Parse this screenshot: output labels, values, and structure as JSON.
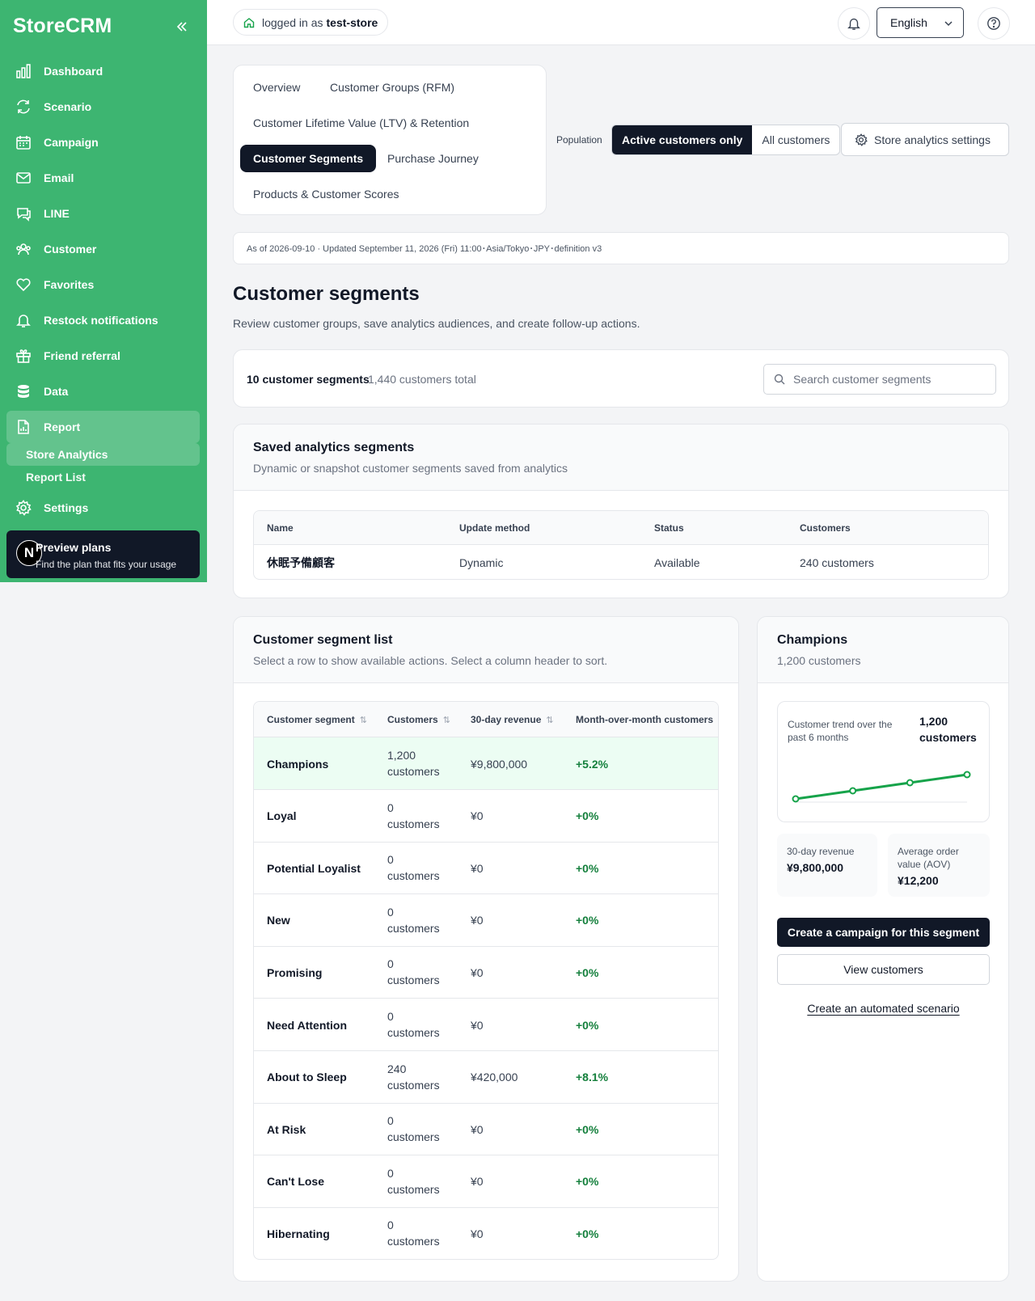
{
  "app": {
    "brand": "StoreCRM"
  },
  "sidebar": {
    "items": [
      {
        "label": "Dashboard",
        "icon": "bar-chart-icon"
      },
      {
        "label": "Scenario",
        "icon": "refresh-icon"
      },
      {
        "label": "Campaign",
        "icon": "calendar-icon"
      },
      {
        "label": "Email",
        "icon": "mail-icon"
      },
      {
        "label": "LINE",
        "icon": "chat-icon"
      },
      {
        "label": "Customer",
        "icon": "users-icon"
      },
      {
        "label": "Favorites",
        "icon": "heart-icon"
      },
      {
        "label": "Restock notifications",
        "icon": "bell-icon"
      },
      {
        "label": "Friend referral",
        "icon": "gift-icon"
      },
      {
        "label": "Data",
        "icon": "database-icon"
      },
      {
        "label": "Report",
        "icon": "report-icon"
      }
    ],
    "sub_items": [
      {
        "label": "Store Analytics"
      },
      {
        "label": "Report List"
      }
    ],
    "settings": {
      "label": "Settings",
      "icon": "gear-icon"
    },
    "plans": {
      "badge": "N",
      "title": "Preview plans",
      "subtitle": "Find the plan that fits your usage"
    }
  },
  "topbar": {
    "login_prefix": "logged in as",
    "store": "test-store",
    "language": "English"
  },
  "tabs": [
    {
      "label": "Overview"
    },
    {
      "label": "Customer Groups (RFM)"
    },
    {
      "label": "Customer Lifetime Value (LTV) & Retention"
    },
    {
      "label": "Customer Segments"
    },
    {
      "label": "Purchase Journey"
    },
    {
      "label": "Products & Customer Scores"
    }
  ],
  "population": {
    "label": "Population",
    "options": [
      "Active customers only",
      "All customers"
    ],
    "selected": "Active customers only",
    "settings_label": "Store analytics settings"
  },
  "asof": "As of 2026-09-10 · Updated September 11, 2026 (Fri) 11:00･Asia/Tokyo･JPY･definition v3",
  "page": {
    "title": "Customer segments",
    "subtitle": "Review customer groups, save analytics audiences, and create follow-up actions."
  },
  "summary": {
    "count": "10 customer segments",
    "total": "1,440 customers total",
    "search_placeholder": "Search customer segments"
  },
  "saved": {
    "title": "Saved analytics segments",
    "subtitle": "Dynamic or snapshot customer segments saved from analytics",
    "columns": [
      "Name",
      "Update method",
      "Status",
      "Customers"
    ],
    "rows": [
      {
        "name": "休眠予備顧客",
        "method": "Dynamic",
        "status": "Available",
        "customers": "240 customers"
      }
    ]
  },
  "segments": {
    "title": "Customer segment list",
    "subtitle": "Select a row to show available actions. Select a column header to sort.",
    "columns": [
      "Customer segment",
      "Customers",
      "30-day revenue",
      "Month-over-month customers"
    ],
    "rows": [
      {
        "name": "Champions",
        "count": "1,200",
        "unit": "customers",
        "revenue": "¥9,800,000",
        "mom": "+5.2%"
      },
      {
        "name": "Loyal",
        "count": "0",
        "unit": "customers",
        "revenue": "¥0",
        "mom": "+0%"
      },
      {
        "name": "Potential Loyalist",
        "count": "0",
        "unit": "customers",
        "revenue": "¥0",
        "mom": "+0%"
      },
      {
        "name": "New",
        "count": "0",
        "unit": "customers",
        "revenue": "¥0",
        "mom": "+0%"
      },
      {
        "name": "Promising",
        "count": "0",
        "unit": "customers",
        "revenue": "¥0",
        "mom": "+0%"
      },
      {
        "name": "Need Attention",
        "count": "0",
        "unit": "customers",
        "revenue": "¥0",
        "mom": "+0%"
      },
      {
        "name": "About to Sleep",
        "count": "240",
        "unit": "customers",
        "revenue": "¥420,000",
        "mom": "+8.1%"
      },
      {
        "name": "At Risk",
        "count": "0",
        "unit": "customers",
        "revenue": "¥0",
        "mom": "+0%"
      },
      {
        "name": "Can't Lose",
        "count": "0",
        "unit": "customers",
        "revenue": "¥0",
        "mom": "+0%"
      },
      {
        "name": "Hibernating",
        "count": "0",
        "unit": "customers",
        "revenue": "¥0",
        "mom": "+0%"
      }
    ]
  },
  "detail": {
    "title": "Champions",
    "subtitle": "1,200 customers",
    "trend_label": "Customer trend over the past 6 months",
    "trend_value": "1,200 customers",
    "revenue_label": "30-day revenue",
    "revenue_value": "¥9,800,000",
    "aov_label": "Average order value (AOV)",
    "aov_value": "¥12,200",
    "primary_action": "Create a campaign for this segment",
    "secondary_action": "View customers",
    "link_action": "Create an automated scenario"
  },
  "chart_data": {
    "type": "line",
    "x": [
      1,
      2,
      3,
      4
    ],
    "values": [
      1,
      2,
      3,
      4
    ],
    "title": "Customer trend over the past 6 months",
    "xlabel": "",
    "ylabel": "",
    "grid": false,
    "color": "#16a34a"
  },
  "colors": {
    "sidebar": "#3db571",
    "dark": "#111827",
    "positive": "#15803d",
    "selected_row": "#ecfdf3"
  }
}
